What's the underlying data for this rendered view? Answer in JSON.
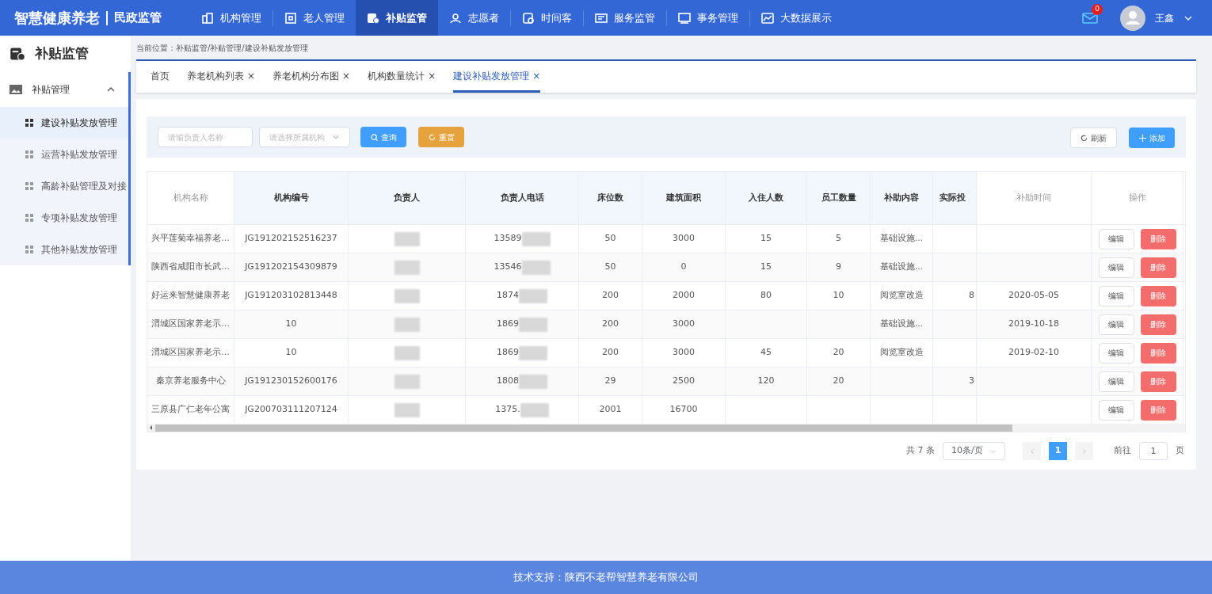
{
  "app": {
    "title": "智慧健康养老",
    "subtitle": "民政监管"
  },
  "nav": [
    {
      "label": "机构管理",
      "selected": false
    },
    {
      "label": "老人管理",
      "selected": false
    },
    {
      "label": "补贴监管",
      "selected": true
    },
    {
      "label": "志愿者",
      "selected": false
    },
    {
      "label": "时间客",
      "selected": false
    },
    {
      "label": "服务监管",
      "selected": false
    },
    {
      "label": "事务管理",
      "selected": false
    },
    {
      "label": "大数据展示",
      "selected": false
    }
  ],
  "user": {
    "mail_count": "0",
    "name": "王鑫"
  },
  "sidebar": {
    "title": "补贴监管",
    "group": {
      "label": "补贴管理",
      "expanded": true,
      "items": [
        {
          "label": "建设补贴发放管理",
          "selected": true
        },
        {
          "label": "运营补贴发放管理",
          "selected": false
        },
        {
          "label": "高龄补贴管理及对接",
          "selected": false
        },
        {
          "label": "专项补贴发放管理",
          "selected": false
        },
        {
          "label": "其他补贴发放管理",
          "selected": false
        }
      ]
    }
  },
  "breadcrumb": "当前位置：补贴监管/补贴管理/建设补贴发放管理",
  "tabs": [
    {
      "label": "首页",
      "selected": false
    },
    {
      "label": "养老机构列表",
      "close": "×",
      "selected": false
    },
    {
      "label": "养老机构分布图",
      "close": "×",
      "selected": false
    },
    {
      "label": "机构数量统计",
      "close": "×",
      "selected": false
    },
    {
      "label": "建设补贴发放管理",
      "close": "×",
      "selected": true
    }
  ],
  "filters": {
    "name_placeholder": "请输负责人名称",
    "org_placeholder": "请选择所属机构",
    "search_label": "查询",
    "reset_label": "重置",
    "refresh_label": "刷新",
    "add_label": "添加"
  },
  "table": {
    "columns": [
      {
        "label": "机构名称",
        "fixed": true,
        "kind": "text"
      },
      {
        "label": "机构编号",
        "fixed": false,
        "kind": "text"
      },
      {
        "label": "负责人",
        "fixed": false,
        "kind": "redacted"
      },
      {
        "label": "负责人电话",
        "fixed": false,
        "kind": "partly_redacted"
      },
      {
        "label": "床位数",
        "fixed": false,
        "kind": "text"
      },
      {
        "label": "建筑面积",
        "fixed": false,
        "kind": "text"
      },
      {
        "label": "入住人数",
        "fixed": false,
        "kind": "text"
      },
      {
        "label": "员工数量",
        "fixed": false,
        "kind": "text"
      },
      {
        "label": "补助内容",
        "fixed": false,
        "kind": "text"
      },
      {
        "label": "实际投",
        "fixed": false,
        "kind": "cut"
      },
      {
        "label": "补助时间",
        "fixed": true,
        "kind": "text"
      },
      {
        "label": "操作",
        "fixed": true,
        "kind": "actions"
      }
    ],
    "rows": [
      {
        "cells": [
          "兴平莲菊幸福养老...",
          "JG191202152516237",
          null,
          "13589",
          "50",
          "3000",
          "15",
          "5",
          "基础设施...",
          null,
          null
        ],
        "actions": [
          {
            "label": "编辑",
            "kind": "plain"
          },
          {
            "label": "删除",
            "kind": "danger"
          }
        ]
      },
      {
        "cells": [
          "陕西省咸阳市长武...",
          "JG191202154309879",
          null,
          "13546",
          "50",
          "0",
          "15",
          "9",
          "基础设施...",
          null,
          null
        ],
        "actions": [
          {
            "label": "编辑",
            "kind": "plain"
          },
          {
            "label": "删除",
            "kind": "danger"
          }
        ]
      },
      {
        "cells": [
          "好运来智慧健康养老",
          "JG191203102813448",
          null,
          "1874",
          "200",
          "2000",
          "80",
          "10",
          "阅览室改造",
          "8",
          "2020-05-05"
        ],
        "actions": [
          {
            "label": "编辑",
            "kind": "plain"
          },
          {
            "label": "删除",
            "kind": "danger"
          }
        ]
      },
      {
        "cells": [
          "渭城区国家养老示...",
          "10",
          null,
          "1869",
          "200",
          "3000",
          null,
          null,
          "基础设施...",
          null,
          "2019-10-18"
        ],
        "actions": [
          {
            "label": "编辑",
            "kind": "plain"
          },
          {
            "label": "删除",
            "kind": "danger"
          }
        ]
      },
      {
        "cells": [
          "渭城区国家养老示...",
          "10",
          null,
          "1869",
          "200",
          "3000",
          "45",
          "20",
          "阅览室改造",
          null,
          "2019-02-10"
        ],
        "actions": [
          {
            "label": "编辑",
            "kind": "plain"
          },
          {
            "label": "删除",
            "kind": "danger"
          }
        ]
      },
      {
        "cells": [
          "秦京养老服务中心",
          "JG191230152600176",
          null,
          "1808",
          "29",
          "2500",
          "120",
          "20",
          null,
          "3",
          null
        ],
        "actions": [
          {
            "label": "编辑",
            "kind": "plain"
          },
          {
            "label": "删除",
            "kind": "danger"
          }
        ]
      },
      {
        "cells": [
          "三原县广仁老年公寓",
          "JG200703111207124",
          null,
          "1375.",
          "2001",
          "16700",
          null,
          null,
          null,
          null,
          null
        ],
        "actions": [
          {
            "label": "编辑",
            "kind": "plain"
          },
          {
            "label": "删除",
            "kind": "danger"
          }
        ]
      }
    ]
  },
  "pagination": {
    "total": "共 7 条",
    "page_size": "10条/页",
    "pages": [
      {
        "label": "1",
        "selected": true
      }
    ],
    "goto_label": "前往",
    "goto_value": "1",
    "page_suffix": "页"
  },
  "footer": "技术支持：陕西不老帮智慧养老有限公司"
}
